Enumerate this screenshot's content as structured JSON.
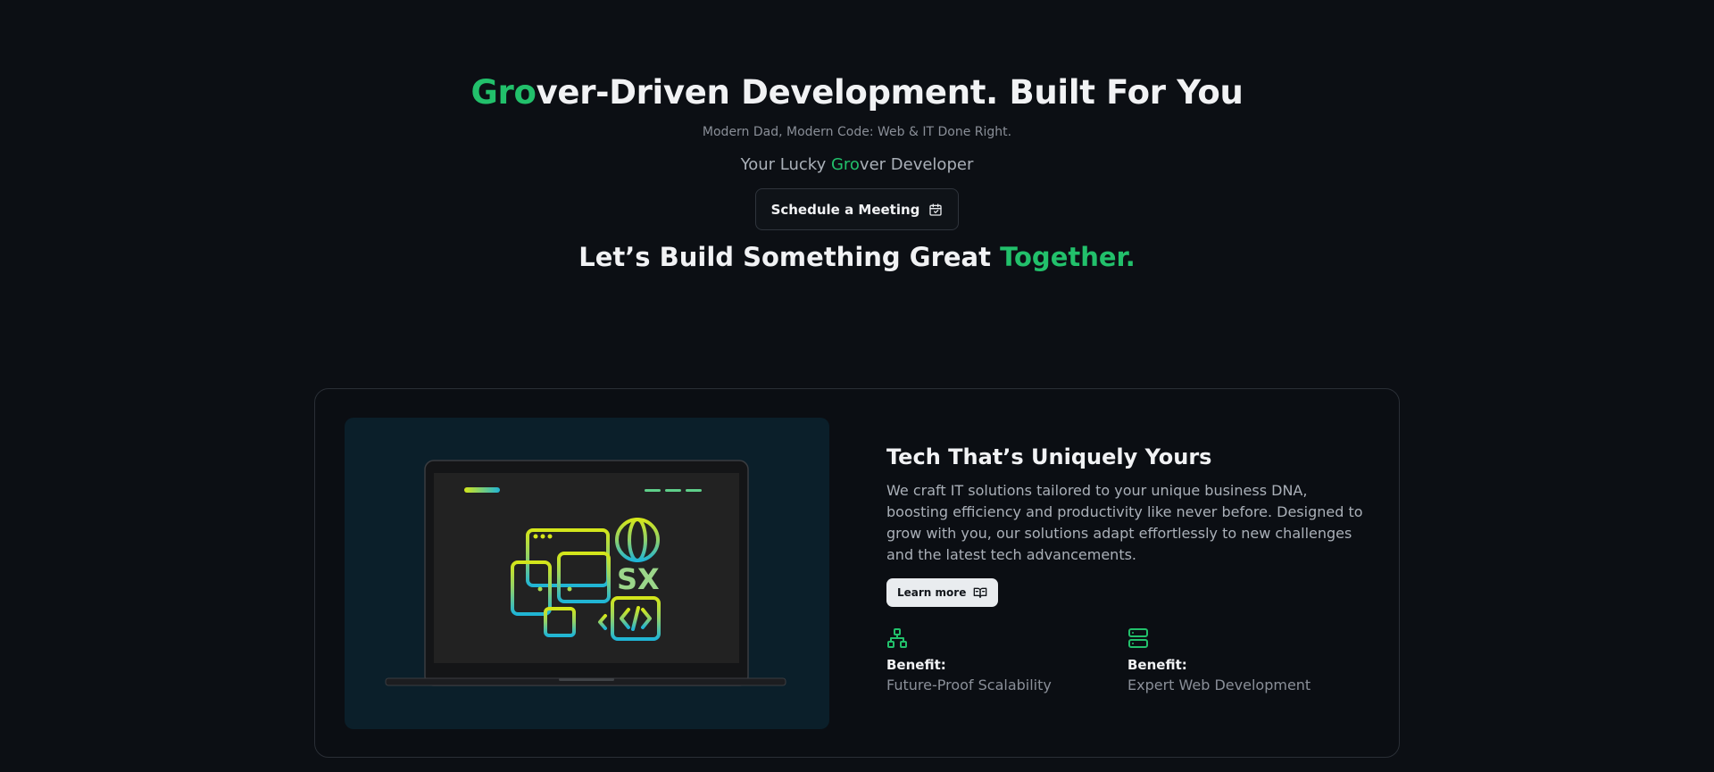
{
  "hero": {
    "title_accent": "Gro",
    "title_rest": "ver-Driven Development. Built For You",
    "tagline": "Modern Dad, Modern Code: Web & IT Done Right.",
    "subtitle_prefix": "Your Lucky ",
    "subtitle_accent": "Gro",
    "subtitle_suffix": "ver Developer",
    "cta_label": "Schedule a Meeting",
    "cta_icon": "calendar-check-icon",
    "closing_main": "Let’s Build Something Great ",
    "closing_accent": "Together."
  },
  "feature": {
    "title": "Tech That’s Uniquely Yours",
    "body": "We craft IT solutions tailored to your unique business DNA, boosting efficiency and productivity like never before. Designed to grow with you, our solutions adapt effortlessly to new challenges and the latest tech advancements.",
    "learn_more_label": "Learn more",
    "learn_more_icon": "book-open-icon",
    "illustration_text": "SX",
    "benefits": [
      {
        "icon": "network-icon",
        "label": "Benefit:",
        "value": "Future-Proof Scalability"
      },
      {
        "icon": "server-icon",
        "label": "Benefit:",
        "value": "Expert Web Development"
      }
    ]
  },
  "colors": {
    "background": "#0c0f14",
    "accent_green": "#22c06b",
    "media_panel": "#0b1f2a",
    "gradient_yellow": "#d4e61a",
    "gradient_cyan": "#1fb5d6"
  }
}
